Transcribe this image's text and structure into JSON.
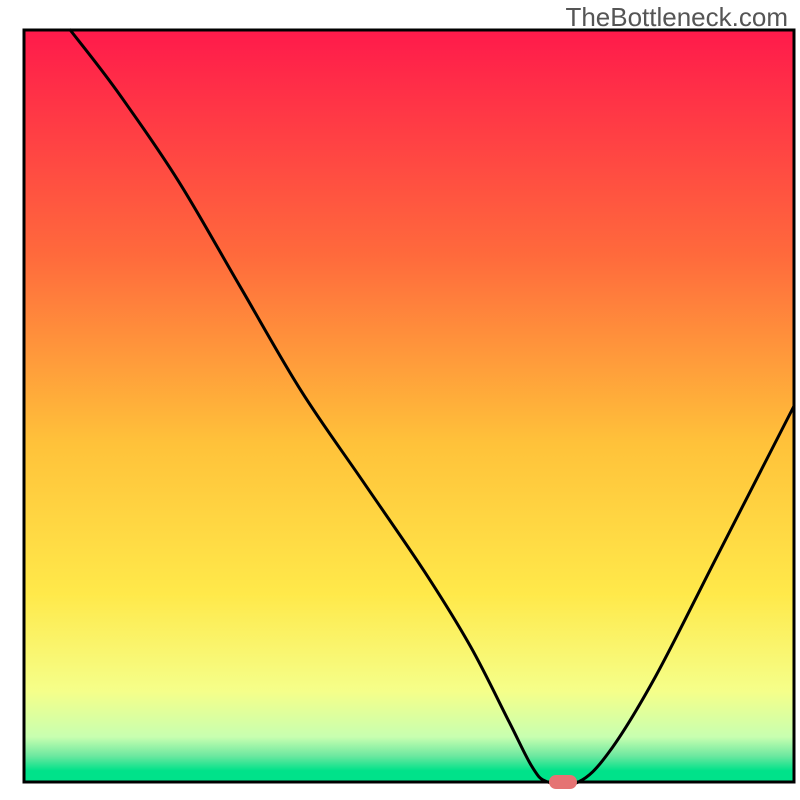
{
  "watermark": "TheBottleneck.com",
  "chart_data": {
    "type": "line",
    "title": "",
    "xlabel": "",
    "ylabel": "",
    "xlim": [
      0,
      100
    ],
    "ylim": [
      0,
      100
    ],
    "series": [
      {
        "name": "bottleneck-curve",
        "x": [
          6,
          12,
          20,
          28,
          36,
          44,
          52,
          58,
          63,
          66,
          68,
          72,
          76,
          82,
          90,
          100
        ],
        "y": [
          100,
          92,
          80,
          66,
          52,
          40,
          28,
          18,
          8,
          2,
          0,
          0,
          4,
          14,
          30,
          50
        ]
      }
    ],
    "marker": {
      "name": "optimal-point",
      "x": 70,
      "y": 0,
      "color": "#e57373"
    },
    "gradient_stops": [
      {
        "offset": 0.0,
        "color": "#ff1a4b"
      },
      {
        "offset": 0.3,
        "color": "#ff6a3c"
      },
      {
        "offset": 0.55,
        "color": "#ffc23a"
      },
      {
        "offset": 0.75,
        "color": "#ffe94a"
      },
      {
        "offset": 0.88,
        "color": "#f5ff8a"
      },
      {
        "offset": 0.94,
        "color": "#c8ffb0"
      },
      {
        "offset": 0.965,
        "color": "#6EE8A0"
      },
      {
        "offset": 0.985,
        "color": "#00e28a"
      },
      {
        "offset": 1.0,
        "color": "#00e28a"
      }
    ]
  }
}
